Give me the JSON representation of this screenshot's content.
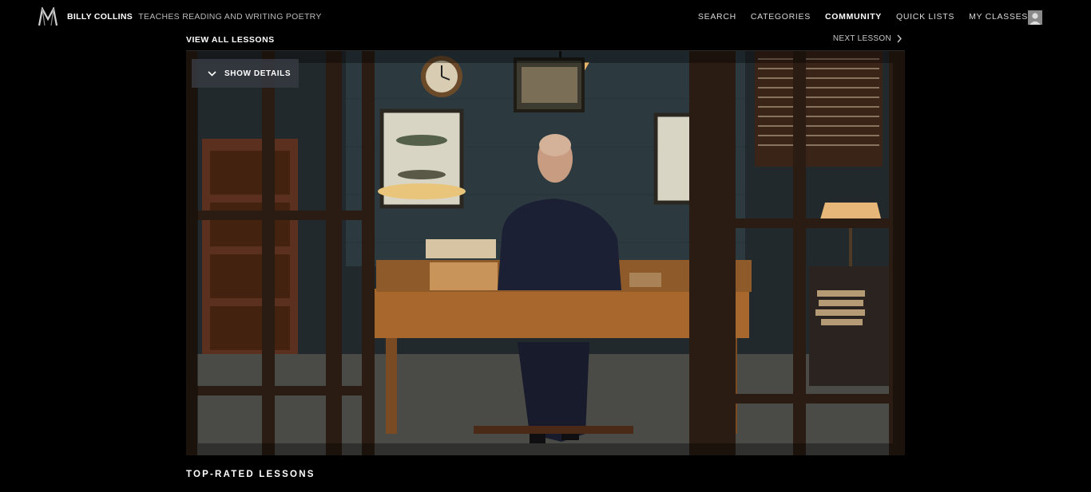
{
  "header": {
    "logo_letter": "M",
    "instructor_name": "BILLY COLLINS",
    "class_tagline": "TEACHES READING AND WRITING POETRY",
    "nav": [
      {
        "label": "SEARCH",
        "active": false
      },
      {
        "label": "CATEGORIES",
        "active": false
      },
      {
        "label": "COMMUNITY",
        "active": true
      },
      {
        "label": "QUICK LISTS",
        "active": false
      },
      {
        "label": "MY CLASSES",
        "active": false
      }
    ],
    "avatar_icon": "user-icon"
  },
  "lesson_bar": {
    "view_all_label": "VIEW ALL LESSONS",
    "next_lesson_label": "NEXT LESSON",
    "next_icon": "chevron-right-icon"
  },
  "video": {
    "show_details_label": "SHOW DETAILS",
    "show_details_icon": "chevron-down-icon"
  },
  "section": {
    "title": "TOP-RATED LESSONS"
  },
  "colors": {
    "background": "#000000",
    "overlay_button": "#34373f",
    "text_primary": "#ffffff",
    "text_secondary": "#b9b9b9"
  }
}
